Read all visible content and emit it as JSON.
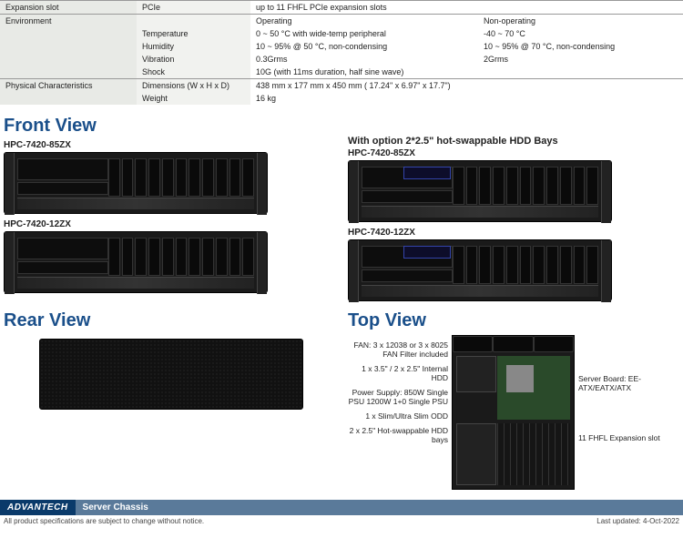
{
  "spec_table": {
    "expansion_slot": {
      "label": "Expansion slot",
      "sub": "PCIe",
      "value": "up to 11 FHFL PCIe expansion slots"
    },
    "environment": {
      "label": "Environment",
      "cols": {
        "op": "Operating",
        "nonop": "Non-operating"
      },
      "rows": [
        {
          "sub": "Temperature",
          "op": "0 ~ 50 °C with wide-temp peripheral",
          "nonop": "-40 ~ 70 °C"
        },
        {
          "sub": "Humidity",
          "op": "10 ~ 95% @ 50 °C, non-condensing",
          "nonop": "10 ~ 95% @ 70 °C, non-condensing"
        },
        {
          "sub": "Vibration",
          "op": "0.3Grms",
          "nonop": "2Grms"
        },
        {
          "sub": "Shock",
          "op": "10G (with 11ms duration, half sine wave)",
          "nonop": ""
        }
      ]
    },
    "physical": {
      "label": "Physical Characteristics",
      "rows": [
        {
          "sub": "Dimensions (W x H x D)",
          "val": "438 mm x 177 mm x 450 mm ( 17.24\" x 6.97\" x 17.7\")"
        },
        {
          "sub": "Weight",
          "val": "16 kg"
        }
      ]
    }
  },
  "sections": {
    "front": "Front View",
    "rear": "Rear View",
    "top": "Top View",
    "option_title": "With option 2*2.5\" hot-swappable HDD Bays"
  },
  "models": {
    "m1": "HPC-7420-85ZX",
    "m2": "HPC-7420-12ZX"
  },
  "top_labels": {
    "fan": "FAN: 3 x 12038 or 3 x 8025 FAN Filter included",
    "hdd_int": "1 x 3.5\" / 2 x 2.5\" Internal HDD",
    "psu": "Power Supply: 850W Single PSU 1200W 1+0 Single PSU",
    "odd": "1 x Slim/Ultra Slim ODD",
    "hdd_swap": "2 x 2.5\" Hot-swappable HDD bays",
    "server_board": "Server Board: EE-ATX/EATX/ATX",
    "exp": "11 FHFL Expansion slot"
  },
  "footer": {
    "brand": "ADVANTECH",
    "title": "Server Chassis",
    "disclaimer": "All product specifications are subject to change without notice.",
    "updated": "Last updated: 4-Oct-2022"
  }
}
